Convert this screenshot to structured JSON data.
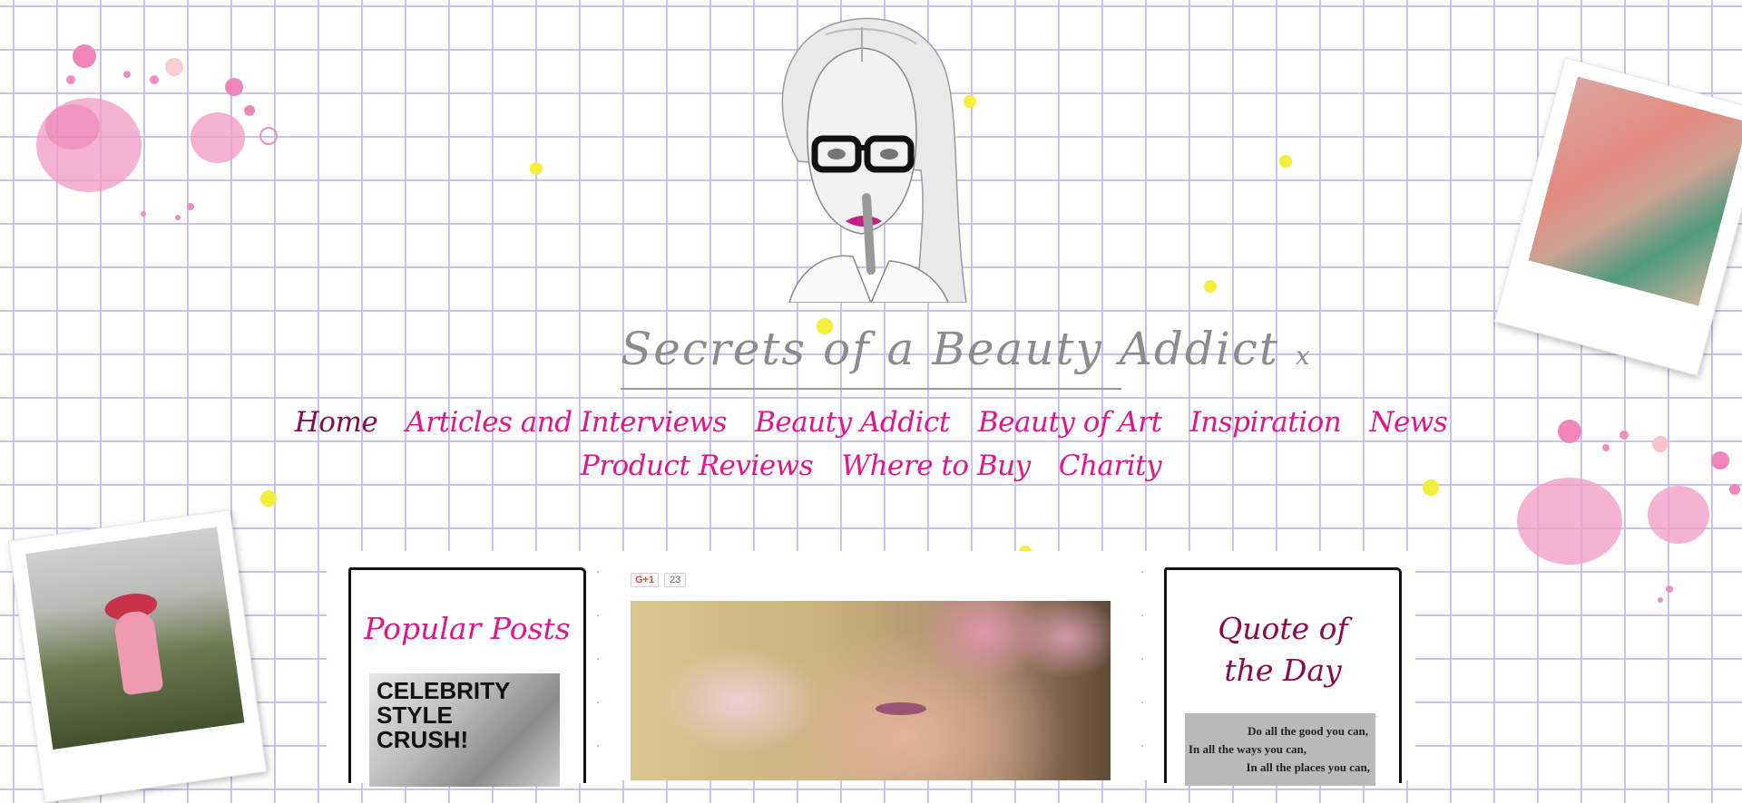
{
  "site": {
    "title": "Secrets of a Beauty Addict",
    "title_suffix": "x"
  },
  "nav": {
    "items": [
      {
        "label": "Home",
        "active": true
      },
      {
        "label": "Articles and Interviews"
      },
      {
        "label": "Beauty Addict"
      },
      {
        "label": "Beauty of Art"
      },
      {
        "label": "Inspiration"
      },
      {
        "label": "News"
      },
      {
        "label": "Product Reviews"
      },
      {
        "label": "Where to Buy"
      },
      {
        "label": "Charity"
      }
    ]
  },
  "popular_posts": {
    "heading": "Popular Posts",
    "thumbnail_text": "CELEBRITY STYLE CRUSH!"
  },
  "social": {
    "gplus_label": "G+1",
    "gplus_count": "23"
  },
  "quote": {
    "heading": "Quote of the Day",
    "lines": [
      "Do all the good you can,",
      "In all the ways you can,",
      "In all the places you can,"
    ]
  },
  "colors": {
    "nav_pink": "#e1168a",
    "nav_active": "#8a0a4f",
    "grid": "#c9c2f0",
    "dots": "#f2ee3a",
    "title_grey": "#8c8c8c",
    "quote_heading": "#8a0a4f"
  }
}
